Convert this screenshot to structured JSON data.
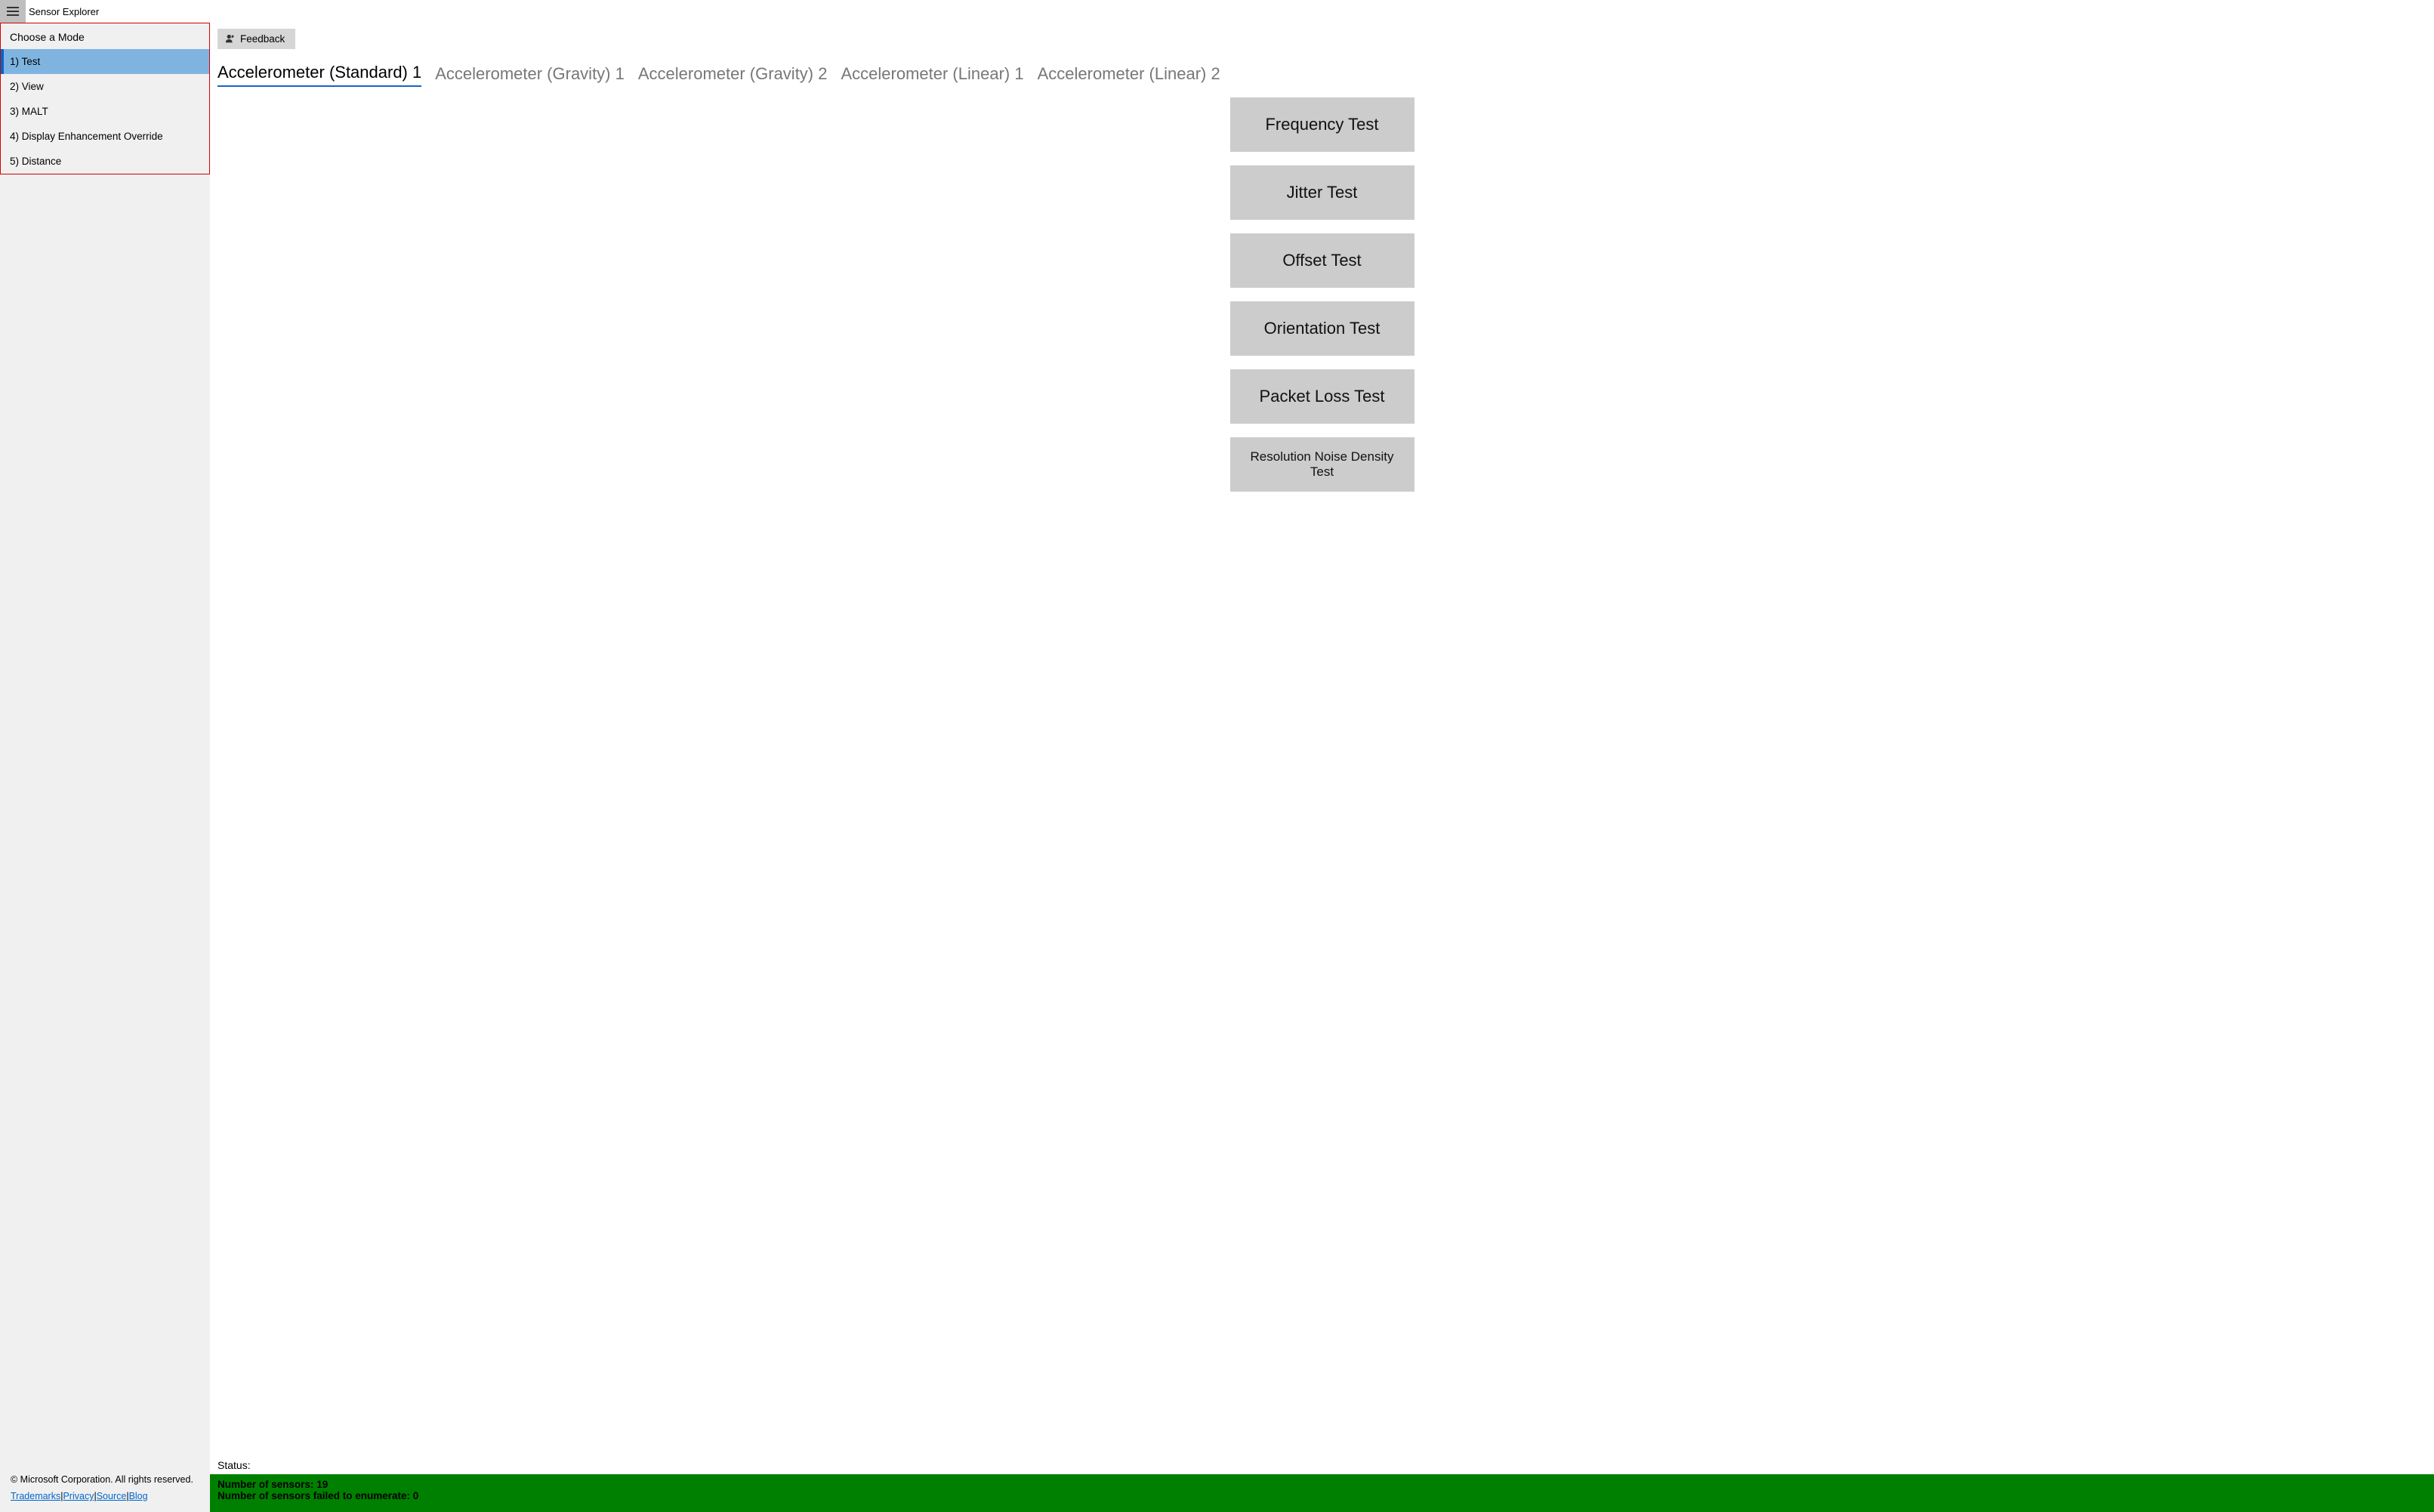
{
  "app_title": "Sensor Explorer",
  "sidebar": {
    "mode_title": "Choose a Mode",
    "items": [
      {
        "label": "1) Test",
        "selected": true
      },
      {
        "label": "2) View",
        "selected": false
      },
      {
        "label": "3) MALT",
        "selected": false
      },
      {
        "label": "4) Display Enhancement Override",
        "selected": false
      },
      {
        "label": "5) Distance",
        "selected": false
      }
    ],
    "copyright": "© Microsoft Corporation. All rights reserved.",
    "links": [
      "Trademarks",
      "Privacy",
      "Source",
      "Blog"
    ]
  },
  "feedback_label": "Feedback",
  "tabs": [
    {
      "label": "Accelerometer (Standard) 1",
      "active": true
    },
    {
      "label": "Accelerometer (Gravity) 1",
      "active": false
    },
    {
      "label": "Accelerometer (Gravity) 2",
      "active": false
    },
    {
      "label": "Accelerometer (Linear) 1",
      "active": false
    },
    {
      "label": "Accelerometer (Linear) 2",
      "active": false
    }
  ],
  "tests": [
    "Frequency Test",
    "Jitter Test",
    "Offset Test",
    "Orientation Test",
    "Packet Loss Test",
    "Resolution Noise Density Test"
  ],
  "status_label": "Status:",
  "status_lines": {
    "line1": "Number of sensors: 19",
    "line2": "Number of sensors failed to enumerate: 0"
  }
}
